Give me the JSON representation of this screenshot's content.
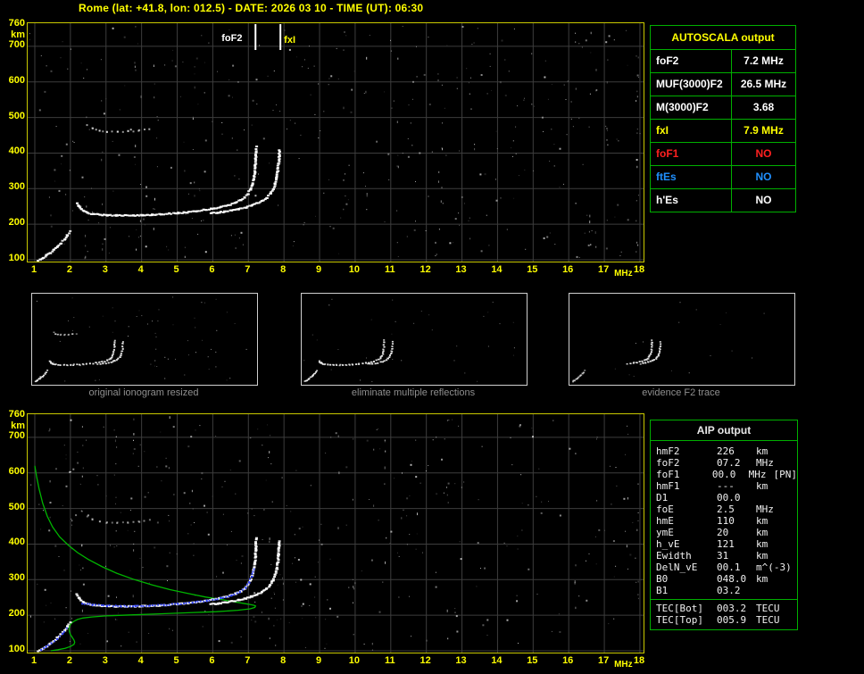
{
  "title": "Rome (lat: +41.8, lon: 012.5) - DATE: 2026 03 10 - TIME (UT): 06:30",
  "colors": {
    "background": "#000000",
    "accent_yellow": "#ffff00",
    "plot_border": "#c9c900",
    "table_border": "#00b000",
    "grid": "#3d3d3d",
    "trace_white": "#ffffff",
    "restored_blue": "#3344ff",
    "profile_green": "#00b400",
    "no_red": "#ff2020",
    "es_blue": "#2090ff",
    "caption_gray": "#8f8f8f"
  },
  "autoscala_table": {
    "header": "AUTOSCALA output",
    "rows": [
      {
        "label": "foF2",
        "value": "7.2 MHz",
        "color": "#ffffff"
      },
      {
        "label": "MUF(3000)F2",
        "value": "26.5 MHz",
        "color": "#ffffff"
      },
      {
        "label": "M(3000)F2",
        "value": "3.68",
        "color": "#ffffff"
      },
      {
        "label": "fxI",
        "value": "7.9 MHz",
        "color": "#ffff00"
      },
      {
        "label": "foF1",
        "value": "NO",
        "color": "#ff2020"
      },
      {
        "label": "ftEs",
        "value": "NO",
        "color": "#2090ff"
      },
      {
        "label": "h'Es",
        "value": "NO",
        "color": "#ffffff"
      }
    ]
  },
  "aip_table": {
    "header": "AIP output",
    "rows": [
      {
        "name": "hmF2",
        "value": "226",
        "unit": "km",
        "extra": ""
      },
      {
        "name": "foF2",
        "value": "07.2",
        "unit": "MHz",
        "extra": ""
      },
      {
        "name": "foF1",
        "value": "00.0",
        "unit": "MHz",
        "extra": "[PN]"
      },
      {
        "name": "hmF1",
        "value": "---",
        "unit": "km",
        "extra": ""
      },
      {
        "name": "D1",
        "value": "00.0",
        "unit": "",
        "extra": ""
      },
      {
        "name": "foE",
        "value": "2.5",
        "unit": "MHz",
        "extra": ""
      },
      {
        "name": "hmE",
        "value": "110",
        "unit": "km",
        "extra": ""
      },
      {
        "name": "ymE",
        "value": "20",
        "unit": "km",
        "extra": ""
      },
      {
        "name": "h_vE",
        "value": "121",
        "unit": "km",
        "extra": ""
      },
      {
        "name": "Ewidth",
        "value": "31",
        "unit": "km",
        "extra": ""
      },
      {
        "name": "DelN_vE",
        "value": "00.1",
        "unit": "m^(-3)",
        "extra": ""
      },
      {
        "name": "B0",
        "value": "048.0",
        "unit": "km",
        "extra": ""
      },
      {
        "name": "B1",
        "value": "03.2",
        "unit": "",
        "extra": ""
      }
    ],
    "tec_rows": [
      {
        "name": "TEC[Bot]",
        "value": "003.2",
        "unit": "TECU",
        "extra": ""
      },
      {
        "name": "TEC[Top]",
        "value": "005.9",
        "unit": "TECU",
        "extra": ""
      }
    ]
  },
  "thumbnails": [
    {
      "caption": "original ionogram resized"
    },
    {
      "caption": "eliminate multiple reflections"
    },
    {
      "caption": "evidence F2 trace"
    }
  ],
  "chart_data": {
    "type": "scatter",
    "description": "Vertical-incidence ionogram (top) and same ionogram with restored trace + electron density profile (bottom)",
    "x_unit": "MHz",
    "y_unit": "km",
    "xlim": [
      1,
      18
    ],
    "ylim": [
      100,
      760
    ],
    "grid": true,
    "x_ticks": [
      1,
      2,
      3,
      4,
      5,
      6,
      7,
      8,
      9,
      10,
      11,
      12,
      13,
      14,
      15,
      16,
      17,
      18
    ],
    "y_ticks": [
      760,
      700,
      600,
      500,
      400,
      300,
      200,
      100
    ],
    "markers": [
      {
        "label": "foF2",
        "f": 7.2,
        "line_color": "#ffffff",
        "label_color": "#ffffff"
      },
      {
        "label": "fxI",
        "f": 7.9,
        "line_color": "#ffffff",
        "label_color": "#ffff00"
      }
    ],
    "traces": {
      "f2_ordinary": {
        "color": "#ffffff",
        "points": [
          [
            2.15,
            262
          ],
          [
            2.2,
            252
          ],
          [
            2.27,
            244
          ],
          [
            2.35,
            238
          ],
          [
            2.45,
            234
          ],
          [
            2.6,
            231
          ],
          [
            2.8,
            229
          ],
          [
            3.0,
            228
          ],
          [
            3.25,
            227
          ],
          [
            3.5,
            227
          ],
          [
            3.75,
            227
          ],
          [
            4.0,
            228
          ],
          [
            4.25,
            229
          ],
          [
            4.5,
            230
          ],
          [
            4.75,
            232
          ],
          [
            5.0,
            234
          ],
          [
            5.25,
            236
          ],
          [
            5.5,
            239
          ],
          [
            5.75,
            243
          ],
          [
            6.0,
            247
          ],
          [
            6.2,
            251
          ],
          [
            6.4,
            256
          ],
          [
            6.6,
            263
          ],
          [
            6.75,
            270
          ],
          [
            6.87,
            278
          ],
          [
            6.95,
            288
          ],
          [
            7.02,
            300
          ],
          [
            7.07,
            314
          ],
          [
            7.11,
            330
          ],
          [
            7.14,
            348
          ],
          [
            7.16,
            368
          ],
          [
            7.17,
            386
          ],
          [
            7.18,
            404
          ],
          [
            7.19,
            420
          ]
        ]
      },
      "f2_extraordinary": {
        "color": "#ffffff",
        "points": [
          [
            5.9,
            233
          ],
          [
            6.1,
            235
          ],
          [
            6.3,
            238
          ],
          [
            6.5,
            241
          ],
          [
            6.7,
            245
          ],
          [
            6.9,
            250
          ],
          [
            7.05,
            255
          ],
          [
            7.2,
            261
          ],
          [
            7.35,
            268
          ],
          [
            7.48,
            277
          ],
          [
            7.58,
            288
          ],
          [
            7.66,
            301
          ],
          [
            7.72,
            316
          ],
          [
            7.76,
            333
          ],
          [
            7.79,
            352
          ],
          [
            7.81,
            372
          ],
          [
            7.83,
            392
          ],
          [
            7.84,
            410
          ]
        ]
      },
      "low_e_trace": {
        "color": "#ffffff",
        "points": [
          [
            1.05,
            100
          ],
          [
            1.12,
            104
          ],
          [
            1.2,
            109
          ],
          [
            1.3,
            115
          ],
          [
            1.4,
            122
          ],
          [
            1.5,
            130
          ],
          [
            1.6,
            139
          ],
          [
            1.7,
            149
          ],
          [
            1.8,
            160
          ],
          [
            1.88,
            171
          ],
          [
            1.95,
            182
          ]
        ]
      },
      "second_hop": {
        "color": "#ffffff",
        "points": [
          [
            2.45,
            480
          ],
          [
            2.6,
            472
          ],
          [
            2.8,
            466
          ],
          [
            3.0,
            463
          ],
          [
            3.3,
            462
          ],
          [
            3.6,
            463
          ],
          [
            3.9,
            466
          ],
          [
            4.2,
            471
          ]
        ]
      },
      "restored_f_trace": {
        "color": "#3344ff",
        "points": [
          [
            2.3,
            236
          ],
          [
            2.6,
            232
          ],
          [
            3.0,
            229
          ],
          [
            3.4,
            228
          ],
          [
            3.8,
            228
          ],
          [
            4.2,
            229
          ],
          [
            4.6,
            231
          ],
          [
            5.0,
            234
          ],
          [
            5.4,
            238
          ],
          [
            5.8,
            243
          ],
          [
            6.2,
            250
          ],
          [
            6.5,
            258
          ],
          [
            6.75,
            268
          ],
          [
            6.9,
            280
          ],
          [
            7.0,
            295
          ],
          [
            7.07,
            312
          ],
          [
            7.12,
            332
          ]
        ]
      },
      "restored_e_trace": {
        "color": "#3344ff",
        "points": [
          [
            1.15,
            106
          ],
          [
            1.3,
            114
          ],
          [
            1.45,
            124
          ],
          [
            1.6,
            136
          ],
          [
            1.75,
            150
          ],
          [
            1.88,
            165
          ]
        ]
      }
    },
    "profile": {
      "name": "electron-density-profile",
      "color": "#00b400",
      "points": [
        [
          1.0,
          620
        ],
        [
          1.05,
          590
        ],
        [
          1.12,
          555
        ],
        [
          1.22,
          515
        ],
        [
          1.35,
          478
        ],
        [
          1.5,
          448
        ],
        [
          1.7,
          420
        ],
        [
          1.95,
          396
        ],
        [
          2.2,
          376
        ],
        [
          2.5,
          357
        ],
        [
          2.9,
          336
        ],
        [
          3.3,
          318
        ],
        [
          3.8,
          300
        ],
        [
          4.3,
          285
        ],
        [
          4.8,
          272
        ],
        [
          5.3,
          261
        ],
        [
          5.8,
          251
        ],
        [
          6.3,
          243
        ],
        [
          6.7,
          236
        ],
        [
          7.0,
          231
        ],
        [
          7.15,
          228
        ],
        [
          7.2,
          226
        ],
        [
          7.18,
          222
        ],
        [
          7.05,
          218
        ],
        [
          6.7,
          214
        ],
        [
          6.1,
          210
        ],
        [
          5.3,
          207
        ],
        [
          4.5,
          204
        ],
        [
          3.7,
          201
        ],
        [
          3.0,
          198
        ],
        [
          2.6,
          195
        ],
        [
          2.35,
          192
        ],
        [
          2.2,
          188
        ],
        [
          2.1,
          183
        ],
        [
          2.02,
          177
        ],
        [
          1.98,
          170
        ],
        [
          1.96,
          162
        ],
        [
          1.97,
          154
        ],
        [
          2.0,
          146
        ],
        [
          2.05,
          138
        ],
        [
          2.1,
          130
        ],
        [
          2.12,
          124
        ],
        [
          2.1,
          118
        ],
        [
          2.0,
          112
        ],
        [
          1.85,
          107
        ],
        [
          1.65,
          103
        ],
        [
          1.45,
          100
        ]
      ]
    }
  }
}
